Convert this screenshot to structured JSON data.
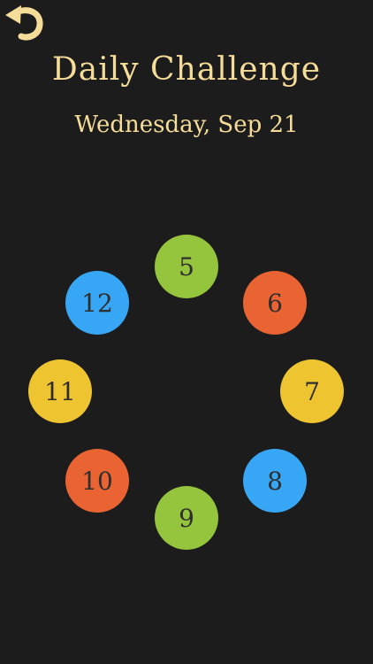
{
  "header": {
    "back_icon": "undo-arrow-icon",
    "title": "Daily Challenge",
    "date": "Wednesday, Sep 21"
  },
  "colors": {
    "background": "#1c1c1c",
    "title_text": "#f5dc98",
    "green": "#95c43d",
    "orange": "#ea6433",
    "yellow": "#eec530",
    "blue": "#37a6f4"
  },
  "tiles": [
    {
      "label": "5",
      "color": "green"
    },
    {
      "label": "6",
      "color": "orange"
    },
    {
      "label": "7",
      "color": "yellow"
    },
    {
      "label": "8",
      "color": "blue"
    },
    {
      "label": "9",
      "color": "green"
    },
    {
      "label": "10",
      "color": "orange"
    },
    {
      "label": "11",
      "color": "yellow"
    },
    {
      "label": "12",
      "color": "blue"
    }
  ]
}
